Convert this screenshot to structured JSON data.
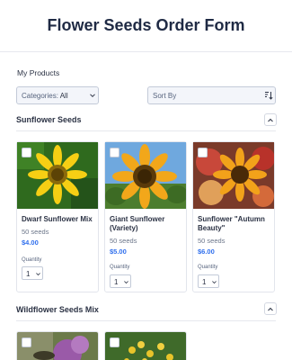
{
  "form": {
    "title": "Flower Seeds Order Form"
  },
  "products": {
    "section_label": "My Products",
    "categories": {
      "label": "Categories:",
      "value": "All"
    },
    "sort": {
      "placeholder": "Sort By"
    }
  },
  "groups": [
    {
      "title": "Sunflower Seeds",
      "items": [
        {
          "name": "Dwarf Sunflower Mix",
          "description": "50 seeds",
          "price": "$4.00",
          "quantity_label": "Quantity",
          "quantity": "1"
        },
        {
          "name": "Giant Sunflower (Variety)",
          "description": "50 seeds",
          "price": "$5.00",
          "quantity_label": "Quantity",
          "quantity": "1"
        },
        {
          "name": "Sunflower \"Autumn Beauty\"",
          "description": "50 seeds",
          "price": "$6.00",
          "quantity_label": "Quantity",
          "quantity": "1"
        }
      ]
    },
    {
      "title": "Wildflower Seeds Mix",
      "items": []
    }
  ],
  "theme": {
    "accent": "#2f6fed",
    "text": "#2c3345",
    "border": "#c3cad8"
  },
  "icons": {
    "collapse": "chevron-up-icon",
    "sort": "sort-icon",
    "dropdown": "chevron-down-icon"
  }
}
